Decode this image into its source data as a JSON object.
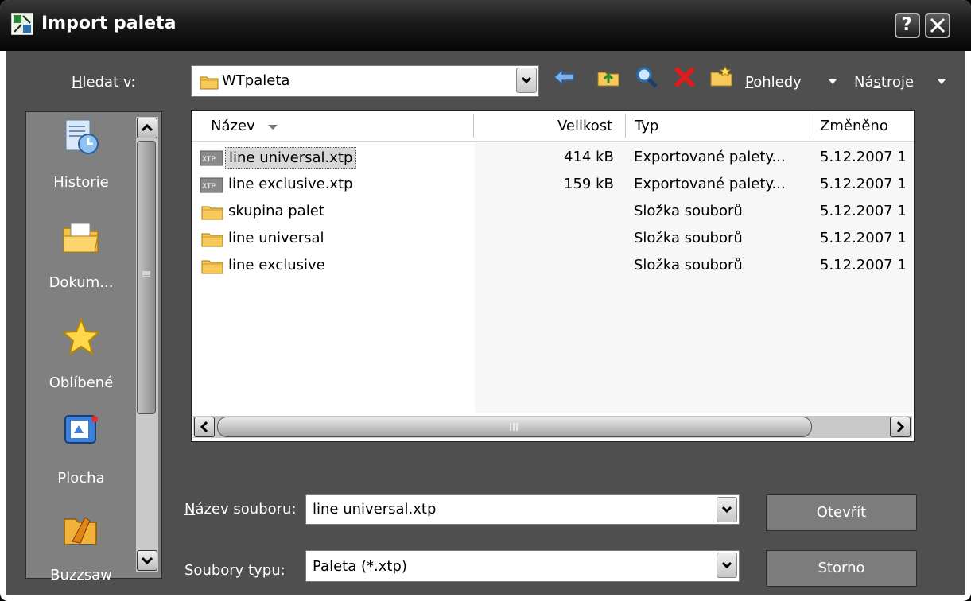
{
  "window": {
    "title": "Import paleta"
  },
  "lookin": {
    "label_prefix": "H",
    "label_rest": "ledat v:",
    "value": "WTpaleta"
  },
  "toolbar": {
    "views_prefix": "P",
    "views_rest": "ohledy",
    "tools_a": "Ná",
    "tools_u": "s",
    "tools_b": "troje"
  },
  "places": [
    {
      "label": "Historie",
      "icon": "history-icon"
    },
    {
      "label": "Dokum...",
      "icon": "documents-folder-icon"
    },
    {
      "label": "Oblíbené",
      "icon": "favorites-star-icon"
    },
    {
      "label": "Plocha",
      "icon": "desktop-icon"
    },
    {
      "label": "Buzzsaw",
      "icon": "buzzsaw-icon"
    }
  ],
  "list": {
    "columns": [
      "Název",
      "Velikost",
      "Typ",
      "Změněno"
    ],
    "rows": [
      {
        "name": "line universal.xtp",
        "size": "414 kB",
        "type": "Exportované palety...",
        "modified": "5.12.2007 1",
        "icon": "xtp-file-icon",
        "selected": true
      },
      {
        "name": "line exclusive.xtp",
        "size": "159 kB",
        "type": "Exportované palety...",
        "modified": "5.12.2007 1",
        "icon": "xtp-file-icon",
        "selected": false
      },
      {
        "name": "skupina palet",
        "size": "",
        "type": "Složka souborů",
        "modified": "5.12.2007 1",
        "icon": "folder-icon",
        "selected": false
      },
      {
        "name": "line universal",
        "size": "",
        "type": "Složka souborů",
        "modified": "5.12.2007 1",
        "icon": "folder-icon",
        "selected": false
      },
      {
        "name": "line exclusive",
        "size": "",
        "type": "Složka souborů",
        "modified": "5.12.2007 1",
        "icon": "folder-icon",
        "selected": false
      }
    ]
  },
  "filename": {
    "label_prefix": "N",
    "label_rest": "ázev souboru:",
    "value": "line universal.xtp"
  },
  "filetype": {
    "label_a": "Soubory ",
    "label_u": "t",
    "label_b": "ypu:",
    "value": "Paleta (*.xtp)"
  },
  "buttons": {
    "open_prefix": "O",
    "open_rest": "tevřít",
    "cancel": "Storno"
  },
  "colors": {
    "dialog_bg": "#4f4f4f",
    "titlebar": "#0d0d0d",
    "places_bg": "#808080",
    "selection": "#d8d8d8"
  }
}
